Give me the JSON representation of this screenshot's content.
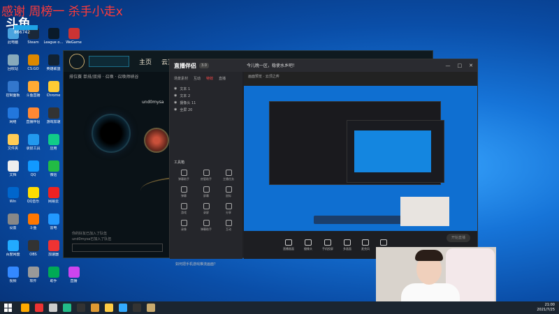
{
  "overlay": {
    "title": "感谢 周榜一 杀手小走x",
    "logo_text": "斗鱼",
    "follower_count": "866742"
  },
  "desktop_icons": [
    {
      "label": "此电脑",
      "color": "#4aa3df"
    },
    {
      "label": "Steam",
      "color": "#1b2838"
    },
    {
      "label": "League of Legends",
      "color": "#0a1a2a"
    },
    {
      "label": "WeGame",
      "color": "#c33"
    },
    {
      "label": "回收站",
      "color": "#8ab"
    },
    {
      "label": "CS:GO",
      "color": "#d80"
    },
    {
      "label": "英雄联盟",
      "color": "#123"
    },
    {
      "label": "腾讯游戏",
      "color": "#16a"
    },
    {
      "label": "控制面板",
      "color": "#37c"
    },
    {
      "label": "斗鱼直播",
      "color": "#fa3"
    },
    {
      "label": "Chrome",
      "color": "#fc3"
    },
    {
      "label": "绝地求生",
      "color": "#b82"
    },
    {
      "label": "网络",
      "color": "#27d"
    },
    {
      "label": "直播伴侣",
      "color": "#f83"
    },
    {
      "label": "游戏加速",
      "color": "#333"
    },
    {
      "label": "YY语音",
      "color": "#c21"
    },
    {
      "label": "文件夹",
      "color": "#fc5"
    },
    {
      "label": "录屏工具",
      "color": "#29e"
    },
    {
      "label": "应用",
      "color": "#1c8"
    },
    {
      "label": "Epic",
      "color": "#222"
    },
    {
      "label": "文档",
      "color": "#eee"
    },
    {
      "label": "QQ",
      "color": "#19f"
    },
    {
      "label": "微信",
      "color": "#2b4"
    },
    {
      "label": "工具",
      "color": "#d33"
    },
    {
      "label": "Win",
      "color": "#06c"
    },
    {
      "label": "QQ音乐",
      "color": "#fd0"
    },
    {
      "label": "网易云",
      "color": "#e22"
    },
    {
      "label": "浏览器",
      "color": "#3a7"
    },
    {
      "label": "设置",
      "color": "#888"
    },
    {
      "label": "斗鱼",
      "color": "#f70"
    },
    {
      "label": "雷电",
      "color": "#29f"
    },
    {
      "label": "LOL",
      "color": "#0b1"
    },
    {
      "label": "百度网盘",
      "color": "#2af"
    },
    {
      "label": "OBS",
      "color": "#333"
    },
    {
      "label": "加速器",
      "color": "#e33"
    },
    {
      "label": "游戏",
      "color": "#fa0"
    },
    {
      "label": "视频",
      "color": "#38f"
    },
    {
      "label": "软件",
      "color": "#999"
    },
    {
      "label": "助手",
      "color": "#0a5"
    },
    {
      "label": "直播",
      "color": "#c4e"
    }
  ],
  "lol_client": {
    "nav_home": "主页",
    "nav_tft": "云顶之",
    "mode": "排位赛 单排/双排 · 召唤 · 召唤师峡谷",
    "summoner": "und0mysa",
    "bottom_lines": [
      "你的好友已加入了队伍",
      "und0mysa已加入了队伍"
    ]
  },
  "stream_app": {
    "logo": "直播伴侣",
    "badge": "3.0",
    "room_title": "今儿晚一区，稳使水乡吧！",
    "tabs": [
      "场景素材",
      "互动",
      "特效",
      "直播"
    ],
    "layers": [
      "文本 1",
      "文本 2",
      "摄像头 11",
      "全屏 20"
    ],
    "tools_title": "工具箱",
    "tools": [
      "弹幕助手",
      "房管助手",
      "主播任务",
      "弹幕",
      "屏幕",
      "鼠标",
      "游戏",
      "录屏",
      "分享",
      "录像",
      "弹幕助手",
      "互动"
    ],
    "tip": "如何把手机游戏推流画面？",
    "preview_header": "画面预览 · 云顶之弈",
    "bottom_buttons": [
      "直播画面",
      "摄像头",
      "手机投屏",
      "多画面",
      "麦克风",
      "扬声器"
    ],
    "live_btn": "开始直播"
  },
  "taskbar": {
    "time": "21:00",
    "date": "2021/7/25",
    "icons": [
      "#fa0",
      "#e33",
      "#ccc",
      "#2b8",
      "#333",
      "#d93",
      "#fc4",
      "#3af",
      "#333",
      "#c8aa6e"
    ]
  }
}
